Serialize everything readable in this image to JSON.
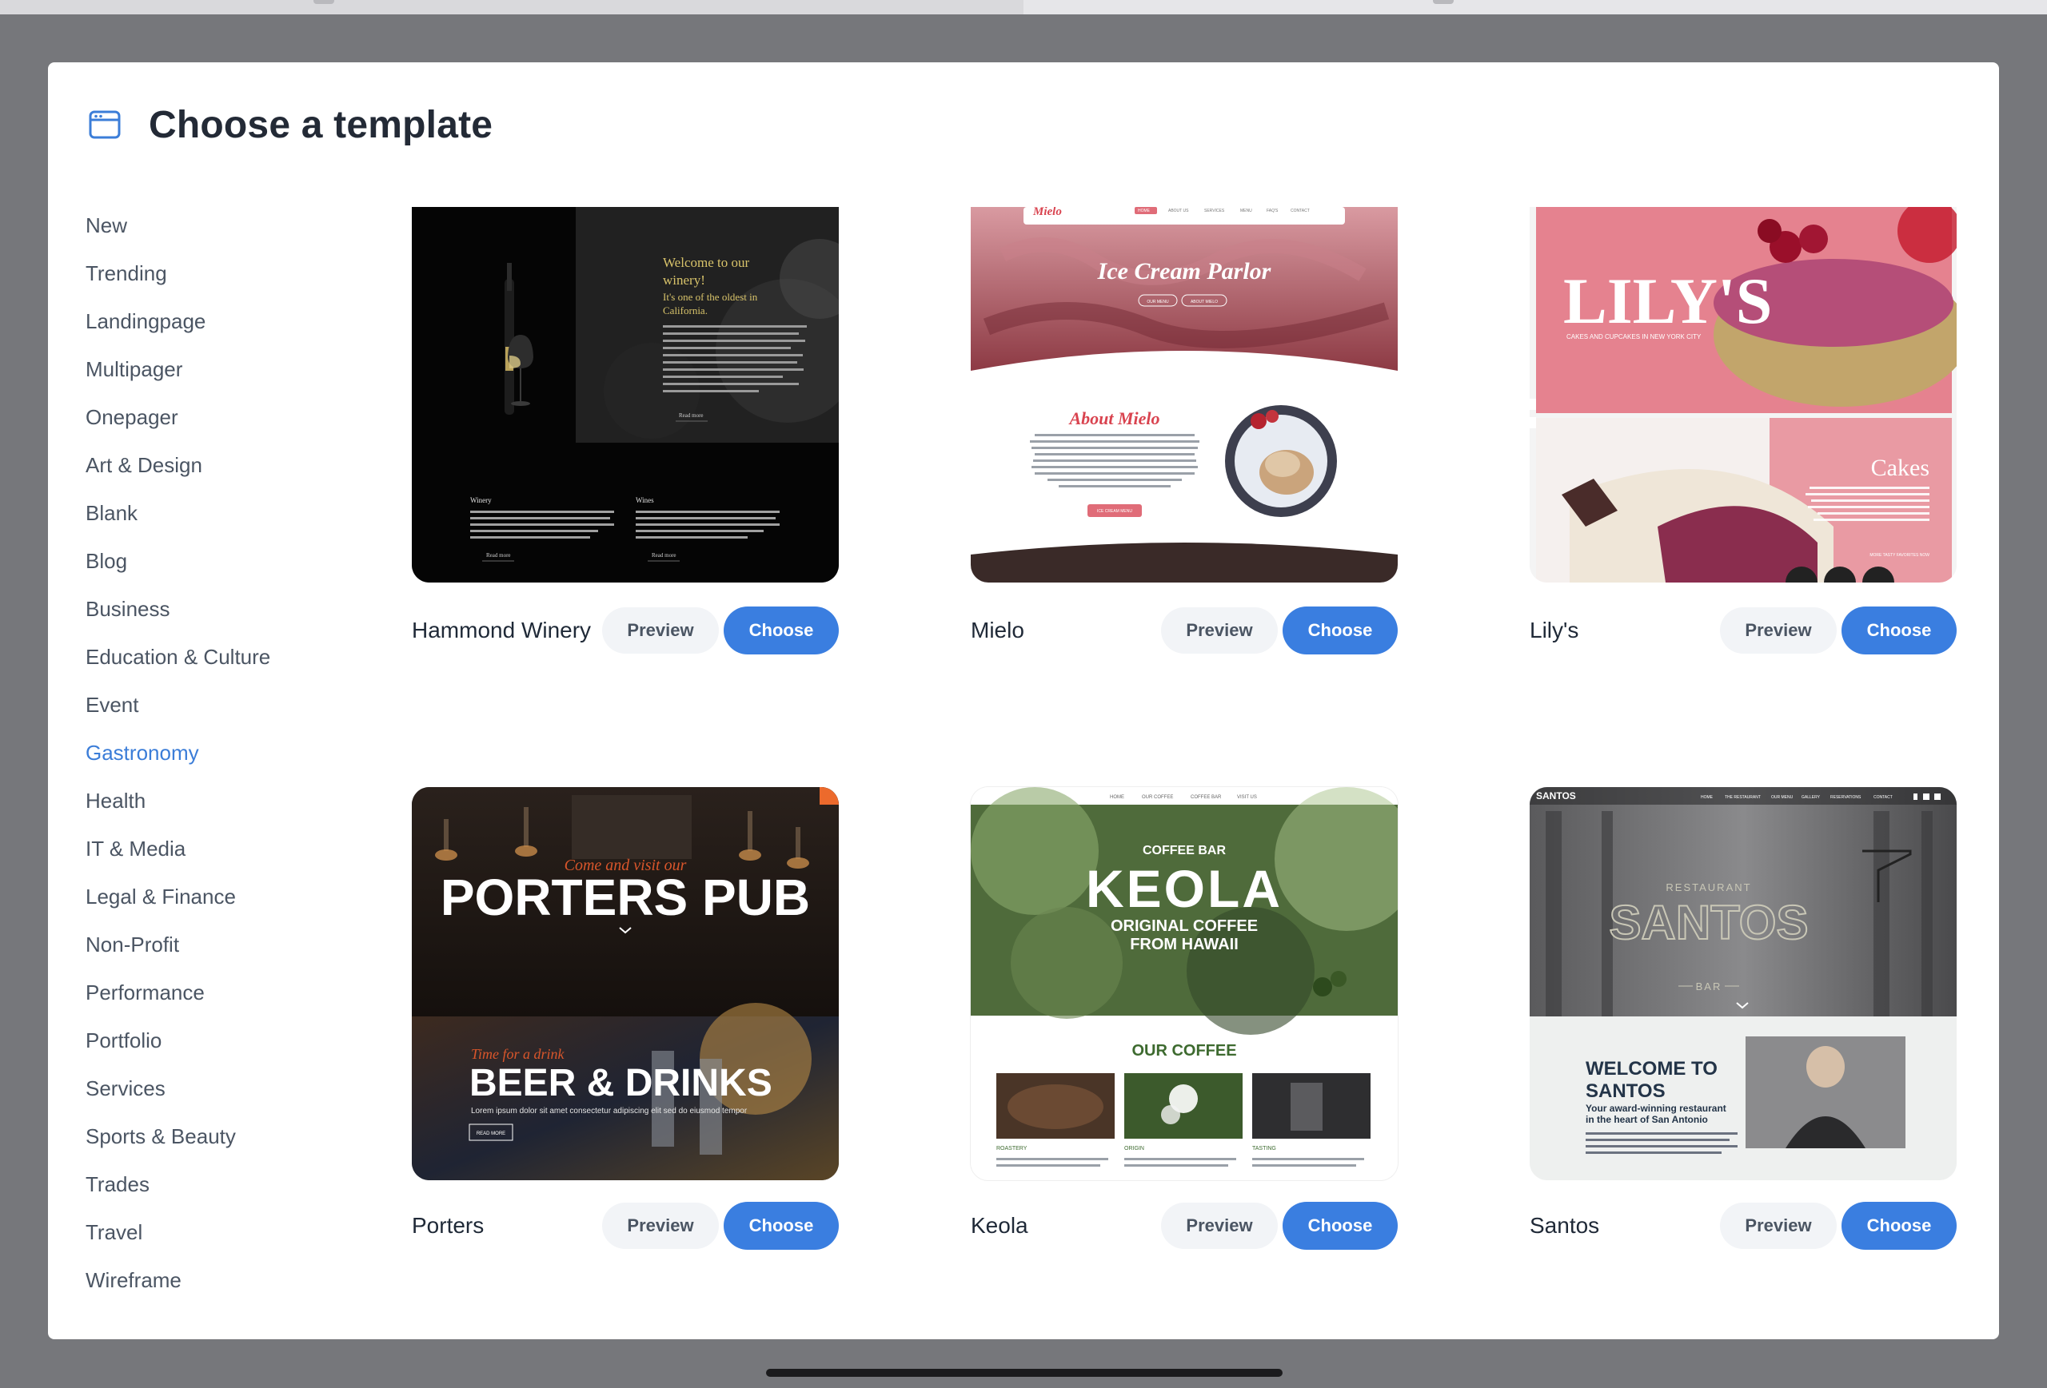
{
  "modal": {
    "title": "Choose a template",
    "icon": "browser-window-icon"
  },
  "sidebar": {
    "items": [
      {
        "label": "New",
        "active": false
      },
      {
        "label": "Trending",
        "active": false
      },
      {
        "label": "Landingpage",
        "active": false
      },
      {
        "label": "Multipager",
        "active": false
      },
      {
        "label": "Onepager",
        "active": false
      },
      {
        "label": "Art & Design",
        "active": false
      },
      {
        "label": "Blank",
        "active": false
      },
      {
        "label": "Blog",
        "active": false
      },
      {
        "label": "Business",
        "active": false
      },
      {
        "label": "Education & Culture",
        "active": false
      },
      {
        "label": "Event",
        "active": false
      },
      {
        "label": "Gastronomy",
        "active": true
      },
      {
        "label": "Health",
        "active": false
      },
      {
        "label": "IT & Media",
        "active": false
      },
      {
        "label": "Legal & Finance",
        "active": false
      },
      {
        "label": "Non-Profit",
        "active": false
      },
      {
        "label": "Performance",
        "active": false
      },
      {
        "label": "Portfolio",
        "active": false
      },
      {
        "label": "Services",
        "active": false
      },
      {
        "label": "Sports & Beauty",
        "active": false
      },
      {
        "label": "Trades",
        "active": false
      },
      {
        "label": "Travel",
        "active": false
      },
      {
        "label": "Wireframe",
        "active": false
      }
    ]
  },
  "buttons": {
    "preview_label": "Preview",
    "choose_label": "Choose"
  },
  "templates": [
    {
      "name": "Hammond Winery",
      "thumb": {
        "heading": [
          "Welcome to our",
          "winery!"
        ],
        "subheading": [
          "It's one of the oldest in",
          "California."
        ],
        "read_more": "Read more",
        "col1": "Winery",
        "col2": "Wines"
      }
    },
    {
      "name": "Mielo",
      "thumb": {
        "logo": "Mielo",
        "nav": [
          "HOME",
          "ABOUT US",
          "SERVICES",
          "MENU",
          "FAQ'S",
          "CONTACT"
        ],
        "headline": "Ice Cream Parlor",
        "btn1": "OUR MENU",
        "btn2": "ABOUT MIELO",
        "about": "About Mielo",
        "cta": "ICE CREAM MENU"
      }
    },
    {
      "name": "Lily's",
      "thumb": {
        "headline": "LILY'S",
        "tagline": "CAKES AND CUPCAKES IN NEW YORK CITY",
        "section": "Cakes",
        "link": "MORE TASTY FAVORITES NOW"
      }
    },
    {
      "name": "Porters",
      "thumb": {
        "script1": "Come and visit our",
        "headline": "PORTERS PUB",
        "script2": "Time for a drink",
        "headline2": "BEER & DRINKS",
        "body": "Lorem ipsum dolor sit amet consectetur adipiscing elit sed do eiusmod tempor",
        "btn": "READ MORE"
      }
    },
    {
      "name": "Keola",
      "thumb": {
        "nav": [
          "HOME",
          "OUR COFFEE",
          "COFFEE BAR",
          "VISIT US"
        ],
        "small": "COFFEE BAR",
        "headline": "KEOLA",
        "sub1": "ORIGINAL COFFEE",
        "sub2": "FROM HAWAII",
        "section": "OUR COFFEE",
        "labels": [
          "ROASTERY",
          "ORIGIN",
          "TASTING"
        ]
      }
    },
    {
      "name": "Santos",
      "thumb": {
        "logo": "SANTOS",
        "nav": [
          "HOME",
          "THE RESTAURANT",
          "OUR MENU",
          "GALLERY",
          "RESERVATIONS",
          "CONTACT"
        ],
        "sign_top": "RESTAURANT",
        "sign_main": "SANTOS",
        "sign_bottom": "BAR",
        "welcome1": "WELCOME TO",
        "welcome2": "SANTOS",
        "tagline1": "Your award-winning restaurant",
        "tagline2": "in the heart of San Antonio"
      }
    }
  ]
}
